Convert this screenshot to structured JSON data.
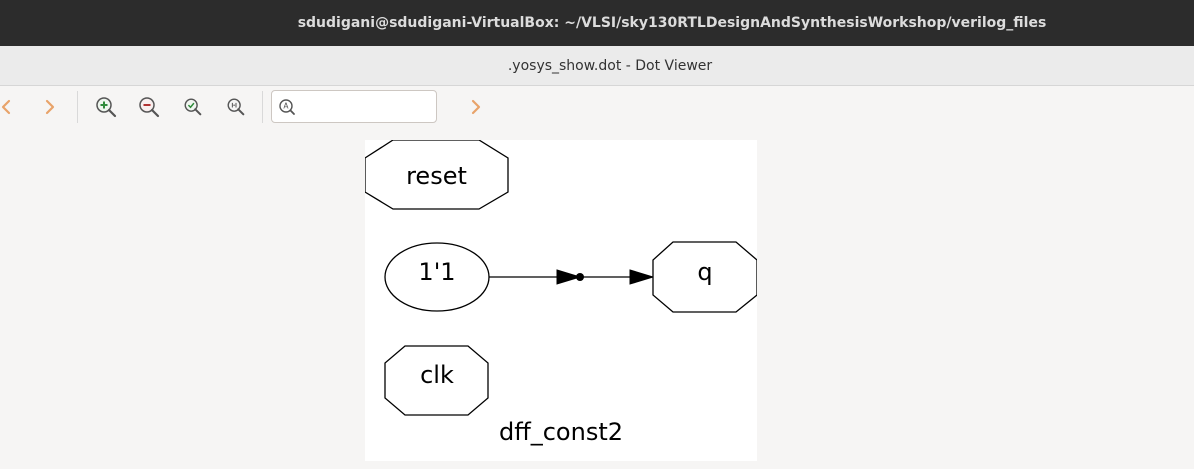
{
  "window": {
    "outer_title": "sdudigani@sdudigani-VirtualBox: ~/VLSI/sky130RTLDesignAndSynthesisWorkshop/verilog_files",
    "inner_title": ".yosys_show.dot - Dot Viewer"
  },
  "toolbar": {
    "back_icon": "chevron-left-icon",
    "forward_icon": "chevron-right-icon",
    "zoom_in_icon": "zoom-in-icon",
    "zoom_out_icon": "zoom-out-icon",
    "zoom_fit_icon": "zoom-fit-icon",
    "zoom_100_icon": "zoom-100-icon",
    "search_placeholder": "",
    "search_value": "",
    "find_next_icon": "chevron-right-icon"
  },
  "graph": {
    "nodes": {
      "reset": "reset",
      "const": "1'1",
      "q": "q",
      "clk": "clk"
    },
    "label": "dff_const2"
  },
  "colors": {
    "titlebar_dark": "#2c2c2c",
    "arrow_orange": "#e8a36a",
    "zoom_in_green": "#2e8b3a",
    "zoom_out_red": "#b03030"
  }
}
